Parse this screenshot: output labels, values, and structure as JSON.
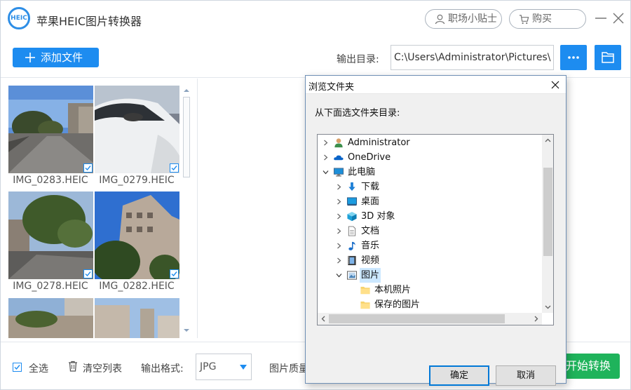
{
  "app": {
    "title": "苹果HEIC图片转换器",
    "logo_text": "HEIC",
    "tips_label": "职场小贴士",
    "buy_label": "购买"
  },
  "toolbar": {
    "add_file_label": "添加文件",
    "output_dir_label": "输出目录:",
    "output_dir_value": "C:\\Users\\Administrator\\Pictures\\",
    "more_label": "•••"
  },
  "thumbnails": [
    {
      "name": "IMG_0283.HEIC",
      "checked": true
    },
    {
      "name": "IMG_0279.HEIC",
      "checked": true
    },
    {
      "name": "IMG_0278.HEIC",
      "checked": true
    },
    {
      "name": "IMG_0282.HEIC",
      "checked": true
    }
  ],
  "bottom": {
    "select_all_label": "全选",
    "clear_list_label": "清空列表",
    "output_format_label": "输出格式:",
    "output_format_value": "JPG",
    "quality_label": "图片质量",
    "start_label": "开始转换"
  },
  "dialog": {
    "title": "浏览文件夹",
    "prompt": "从下面选文件夹目录:",
    "tree": [
      {
        "label": "Administrator",
        "icon": "user-icon",
        "expander": "collapsed"
      },
      {
        "label": "OneDrive",
        "icon": "cloud-icon",
        "expander": "collapsed"
      },
      {
        "label": "此电脑",
        "icon": "computer-icon",
        "expander": "expanded"
      },
      {
        "label": "下载",
        "icon": "download-icon",
        "expander": "collapsed"
      },
      {
        "label": "桌面",
        "icon": "desktop-icon",
        "expander": "collapsed"
      },
      {
        "label": "3D 对象",
        "icon": "cube-3d-icon",
        "expander": "collapsed"
      },
      {
        "label": "文档",
        "icon": "document-icon",
        "expander": "collapsed"
      },
      {
        "label": "音乐",
        "icon": "music-icon",
        "expander": "collapsed"
      },
      {
        "label": "视频",
        "icon": "video-icon",
        "expander": "collapsed"
      },
      {
        "label": "图片",
        "icon": "picture-icon",
        "expander": "expanded",
        "selected": true
      },
      {
        "label": "本机照片",
        "icon": "folder-icon",
        "expander": "none"
      },
      {
        "label": "保存的图片",
        "icon": "folder-icon",
        "expander": "none"
      }
    ],
    "ok_label": "确定",
    "cancel_label": "取消"
  },
  "colors": {
    "accent": "#1d8cf0",
    "start": "#1fb35b",
    "selection": "#cce8ff"
  }
}
